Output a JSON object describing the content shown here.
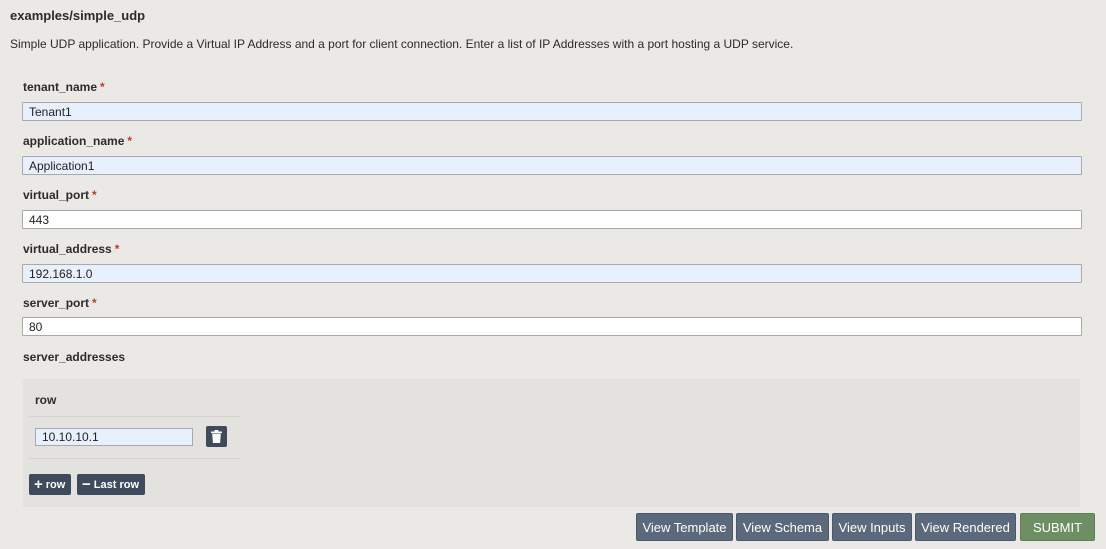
{
  "page": {
    "title": "examples/simple_udp",
    "description": "Simple UDP application. Provide a Virtual IP Address and a port for client connection. Enter a list of IP Addresses with a port hosting a UDP service."
  },
  "fields": [
    {
      "label": "tenant_name",
      "required_mark": "*",
      "value": "Tenant1"
    },
    {
      "label": "application_name",
      "required_mark": "*",
      "value": "Application1"
    },
    {
      "label": "virtual_port",
      "required_mark": "*",
      "value": "443"
    },
    {
      "label": "virtual_address",
      "required_mark": "*",
      "value": "192.168.1.0"
    },
    {
      "label": "server_port",
      "required_mark": "*",
      "value": "80"
    }
  ],
  "server_addresses": {
    "label": "server_addresses",
    "column_header": "row",
    "rows": [
      "10.10.10.1"
    ],
    "add_row_glyph": "+",
    "add_row_label": "row",
    "remove_row_glyph": "−",
    "remove_row_label": "Last row",
    "delete_icon": "trash-icon"
  },
  "actions": {
    "view_template": "View Template",
    "view_schema": "View Schema",
    "view_inputs": "View Inputs",
    "view_rendered": "View Rendered",
    "submit": "SUBMIT"
  },
  "colors": {
    "background": "#ebe9e5",
    "button_dark": "#3d4b5c",
    "button_slate": "#5a6a7c",
    "submit_green": "#6d8f63",
    "required_red": "#c0392b",
    "autofill_blue": "#e8f0fe"
  }
}
